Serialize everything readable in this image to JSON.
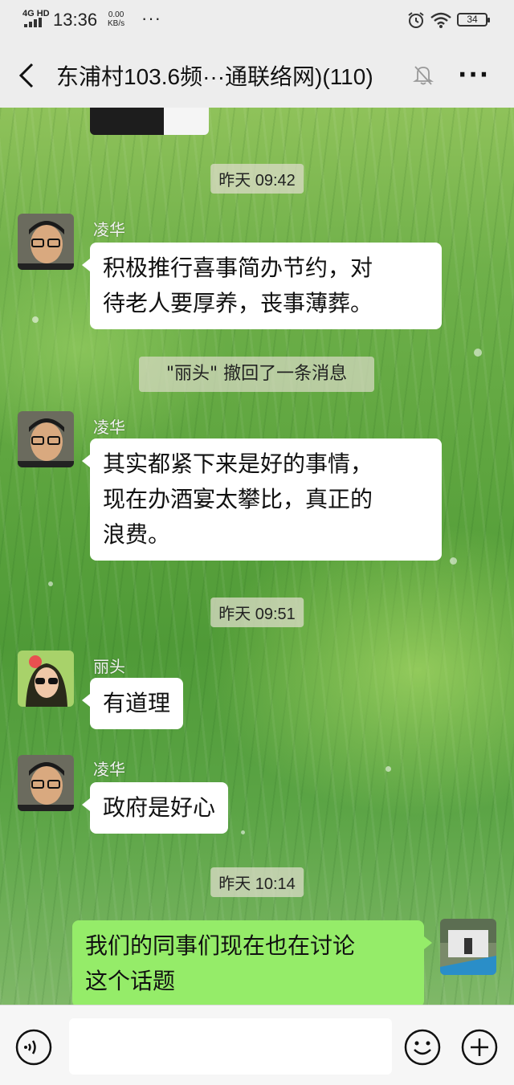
{
  "status_bar": {
    "network": "4G HD",
    "time": "13:36",
    "speed_value": "0.00",
    "speed_unit": "KB/s",
    "more": "···",
    "battery": "34"
  },
  "header": {
    "title": "东浦村103.6频···通联络网)(110)",
    "more": "···"
  },
  "messages": [
    {
      "type": "time",
      "text": "昨天 09:42"
    },
    {
      "type": "msg",
      "sender": "凌华",
      "lines": [
        "积极推行喜事简办节约，对",
        "待老人要厚养，丧事薄葬。"
      ]
    },
    {
      "type": "recall",
      "text": "\"丽头\" 撤回了一条消息"
    },
    {
      "type": "msg",
      "sender": "凌华",
      "lines": [
        "其实都紧下来是好的事情，",
        "现在办酒宴太攀比，真正的",
        "浪费。"
      ]
    },
    {
      "type": "time",
      "text": "昨天 09:51"
    },
    {
      "type": "msg",
      "sender": "丽头",
      "lines": [
        "有道理"
      ]
    },
    {
      "type": "msg",
      "sender": "凌华",
      "lines": [
        "政府是好心"
      ]
    },
    {
      "type": "time",
      "text": "昨天 10:14"
    },
    {
      "type": "self",
      "lines": [
        "我们的同事们现在也在讨论",
        "这个话题"
      ]
    }
  ],
  "input": {
    "placeholder": ""
  },
  "colors": {
    "self_bubble": "#95ec69",
    "other_bubble": "#ffffff",
    "bar_bg": "#ededed"
  }
}
